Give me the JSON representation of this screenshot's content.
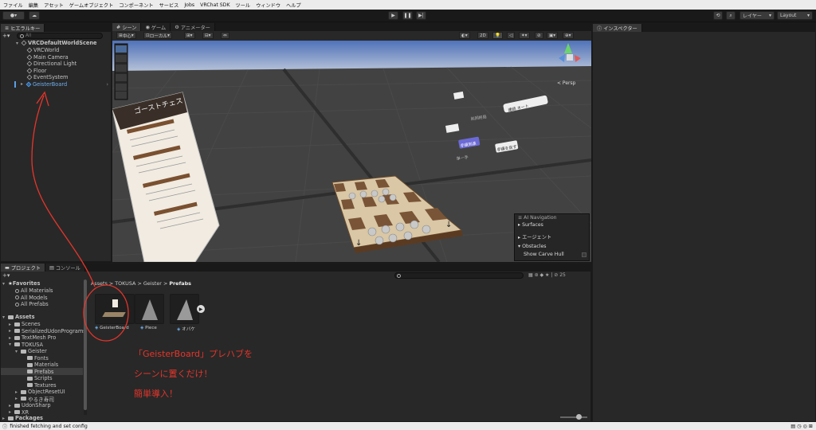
{
  "menu": [
    "ファイル",
    "編集",
    "アセット",
    "ゲームオブジェクト",
    "コンポーネント",
    "サービス",
    "Jobs",
    "VRChat SDK",
    "ツール",
    "ウィンドウ",
    "ヘルプ"
  ],
  "toolbar": {
    "layers_label": "レイヤー",
    "layout_label": "Layout"
  },
  "hierarchy": {
    "tab": "ヒエラルキー",
    "search_placeholder": "All",
    "scene_name": "VRCDefaultWorldScene",
    "items": [
      "VRCWorld",
      "Main Camera",
      "Directional Light",
      "Floor",
      "EventSystem",
      "GeisterBoard"
    ]
  },
  "scene": {
    "tabs": [
      "シーン",
      "ゲーム",
      "アニメーター"
    ],
    "pivot_label": "中心",
    "space_label": "ローカル",
    "mode_2d": "2D",
    "persp_label": "< Persp",
    "board_title": "ゴーストチェス",
    "menu_labels": [
      "最初から",
      "連続 オート",
      "一般手",
      "手順を戻す",
      "前回終局",
      "手順到達",
      "単一手"
    ]
  },
  "nav_overlay": {
    "title": "AI Navigation",
    "items": [
      "Surfaces",
      "エージェント",
      "Obstacles",
      "Show Carve Hull"
    ]
  },
  "project": {
    "tabs": [
      "プロジェクト",
      "コンソール"
    ],
    "zoom_count": "25",
    "breadcrumb": [
      "Assets",
      "TOKUSA",
      "Geister",
      "Prefabs"
    ],
    "favorites_label": "Favorites",
    "favorites": [
      "All Materials",
      "All Models",
      "All Prefabs"
    ],
    "assets_label": "Assets",
    "tree": [
      "Scenes",
      "SerializedUdonPrograms",
      "TextMesh Pro",
      "TOKUSA",
      "Geister",
      "Fonts",
      "Materials",
      "Prefabs",
      "Scripts",
      "Textures",
      "ObjectResetUI",
      "やるき寿司",
      "UdonSharp",
      "XR"
    ],
    "packages_label": "Packages",
    "assets": [
      "GeisterBoard",
      "Piece",
      "オバケ"
    ]
  },
  "inspector": {
    "tab": "インスペクター"
  },
  "annotation": {
    "lines": [
      "「GeisterBoard」プレハブを",
      "シーンに置くだけ！",
      "簡単導入！"
    ],
    "color": "#e6352b"
  },
  "status": {
    "message": "finished fetching and set config"
  }
}
